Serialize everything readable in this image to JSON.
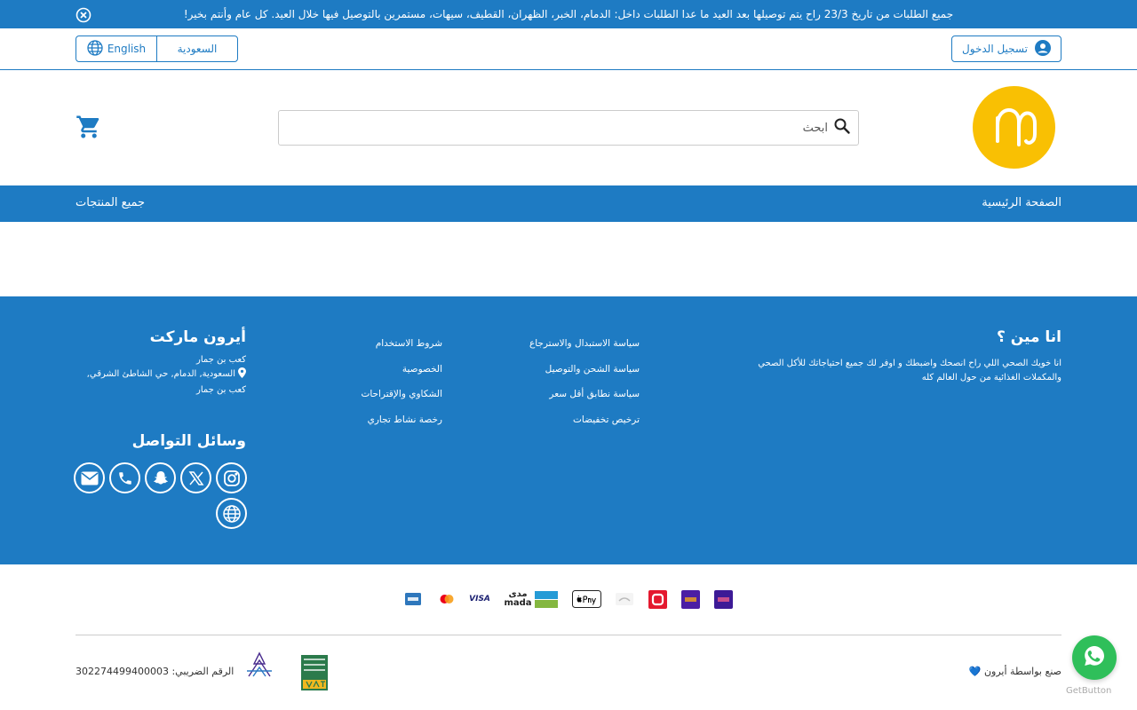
{
  "announcement": {
    "text": "جميع الطلبات من تاريخ 23/3 راح يتم توصيلها بعد العيد ما عدا الطلبات داخل: الدمام، الخبر، الظهران، القطيف، سيهات، مستمرين بالتوصيل فيها خلال العيد. كل عام وأنتم بخير!"
  },
  "utility": {
    "login": "تسجيل الدخول",
    "lang_en": "English",
    "country": "السعودية"
  },
  "search": {
    "placeholder": "ابحث"
  },
  "nav": {
    "home": "الصفحة الرئيسية",
    "all_products": "جميع المنتجات"
  },
  "footer": {
    "about": {
      "title": "انا مين ؟",
      "text": "انا خويك الصحي اللي راح انصحك واضبطك و اوفر لك جميع احتياجاتك للأكل الصحي والمكملات الغذائية من حول العالم كله"
    },
    "links_col1": [
      "سياسة الاستبدال والاسترجاع",
      "سياسة الشحن والتوصيل",
      "سياسة نطابق أقل سعر",
      "ترخيص تخفيضات"
    ],
    "links_col2": [
      "شروط الاستخدام",
      "الخصوصية",
      "الشكاوي والإقتراحات",
      "رخصة نشاط تجاري"
    ],
    "store": {
      "title": "أيرون ماركت",
      "owner": "كعب بن جمار",
      "address": "السعودية, الدمام, حي الشاطئ الشرقي, كعب بن جمار"
    },
    "social_title": "وسائل التواصل"
  },
  "payments": {
    "mada": "مدى",
    "mada_latin": "mada",
    "visa": "VISA"
  },
  "bottom": {
    "credit": "صنع بواسطة أيرون",
    "credit_heart": "💙",
    "tax": "الرقم الضريبي: 302274499400003",
    "getbutton": "GetButton"
  },
  "colors": {
    "primary": "#1e7bc3",
    "logo": "#f9c003",
    "whatsapp": "#2fbf5a"
  }
}
